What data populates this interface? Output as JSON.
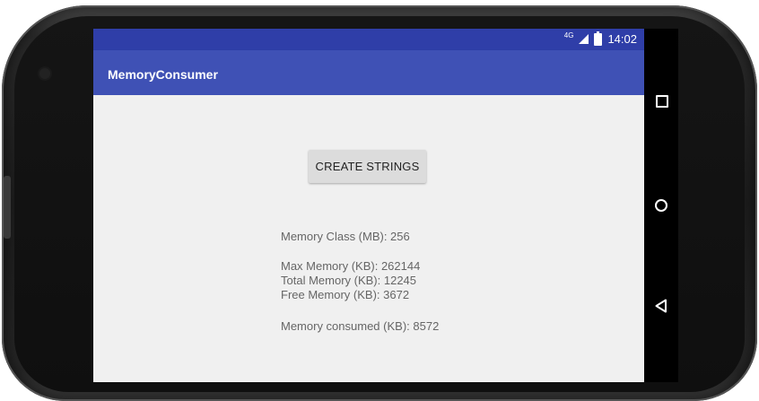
{
  "status_bar": {
    "network": "4G",
    "time": "14:02"
  },
  "app_bar": {
    "title": "MemoryConsumer"
  },
  "main": {
    "create_button_label": "CREATE STRINGS",
    "memory_class": "Memory Class (MB): 256",
    "max_memory": "Max Memory (KB): 262144",
    "total_memory": "Total Memory (KB): 12245",
    "free_memory": "Free Memory (KB): 3672",
    "memory_consumed": "Memory consumed (KB): 8572"
  },
  "nav_bar": {
    "icons": [
      "recent-apps-icon",
      "home-icon",
      "back-icon"
    ]
  },
  "colors": {
    "status_bar": "#2f3ea8",
    "app_bar": "#3f51b5",
    "content_background": "#f0f0f0",
    "button": "#dcdcdc"
  }
}
